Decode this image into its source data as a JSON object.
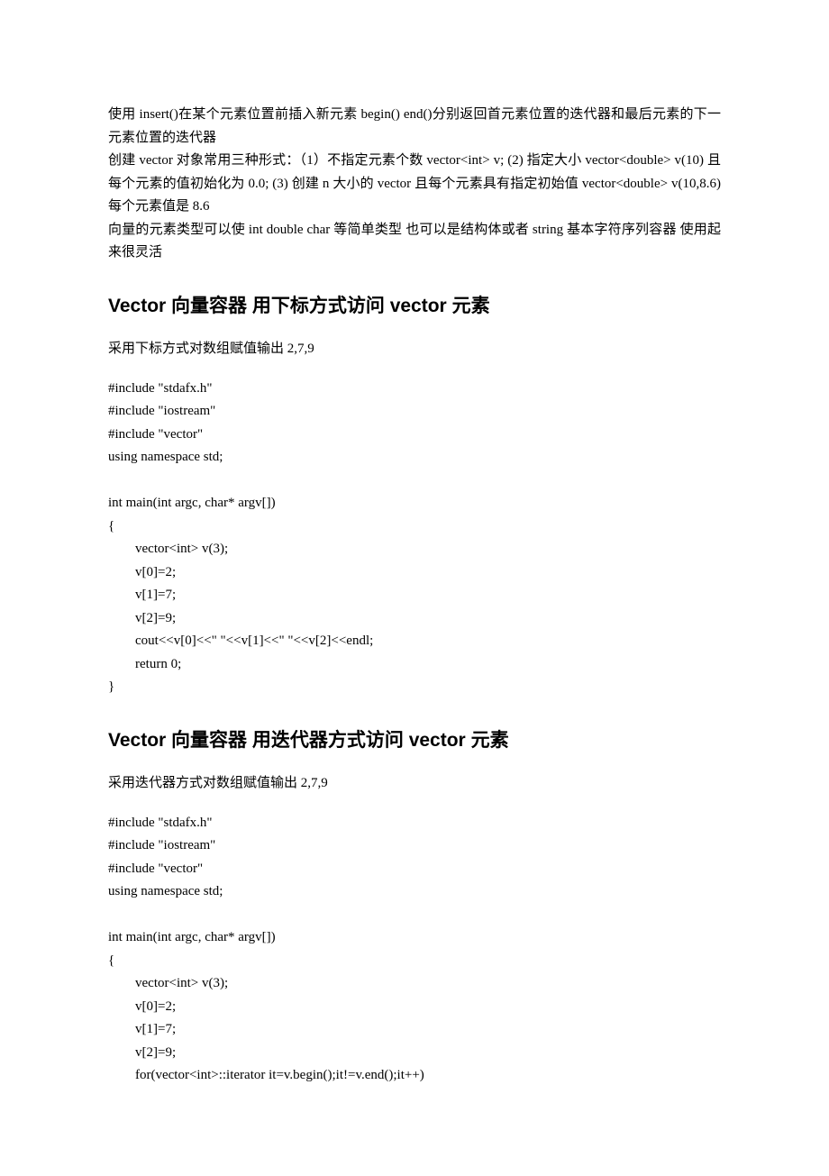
{
  "intro": {
    "p1": "使用 insert()在某个元素位置前插入新元素  begin() end()分别返回首元素位置的迭代器和最后元素的下一元素位置的迭代器",
    "p2": "创建 vector 对象常用三种形式：（1）不指定元素个数  vector<int> v;  (2)  指定大小  vector<double> v(10)  且每个元素的值初始化为 0.0; (3)  创建 n 大小的 vector  且每个元素具有指定初始值  vector<double> v(10,8.6)  每个元素值是 8.6",
    "p3": "向量的元素类型可以使 int double char  等简单类型  也可以是结构体或者 string 基本字符序列容器  使用起来很灵活"
  },
  "section1": {
    "heading": "Vector 向量容器  用下标方式访问 vector 元素",
    "desc": "采用下标方式对数组赋值输出 2,7,9",
    "code": "#include \"stdafx.h\"\n#include \"iostream\"\n#include \"vector\"\nusing namespace std;\n\nint main(int argc, char* argv[])\n{\n        vector<int> v(3);\n        v[0]=2;\n        v[1]=7;\n        v[2]=9;\n        cout<<v[0]<<\" \"<<v[1]<<\" \"<<v[2]<<endl;\n        return 0;\n}"
  },
  "section2": {
    "heading": "Vector 向量容器  用迭代器方式访问 vector 元素",
    "desc": "采用迭代器方式对数组赋值输出 2,7,9",
    "code": "#include \"stdafx.h\"\n#include \"iostream\"\n#include \"vector\"\nusing namespace std;\n\nint main(int argc, char* argv[])\n{\n        vector<int> v(3);\n        v[0]=2;\n        v[1]=7;\n        v[2]=9;\n        for(vector<int>::iterator it=v.begin();it!=v.end();it++)"
  }
}
